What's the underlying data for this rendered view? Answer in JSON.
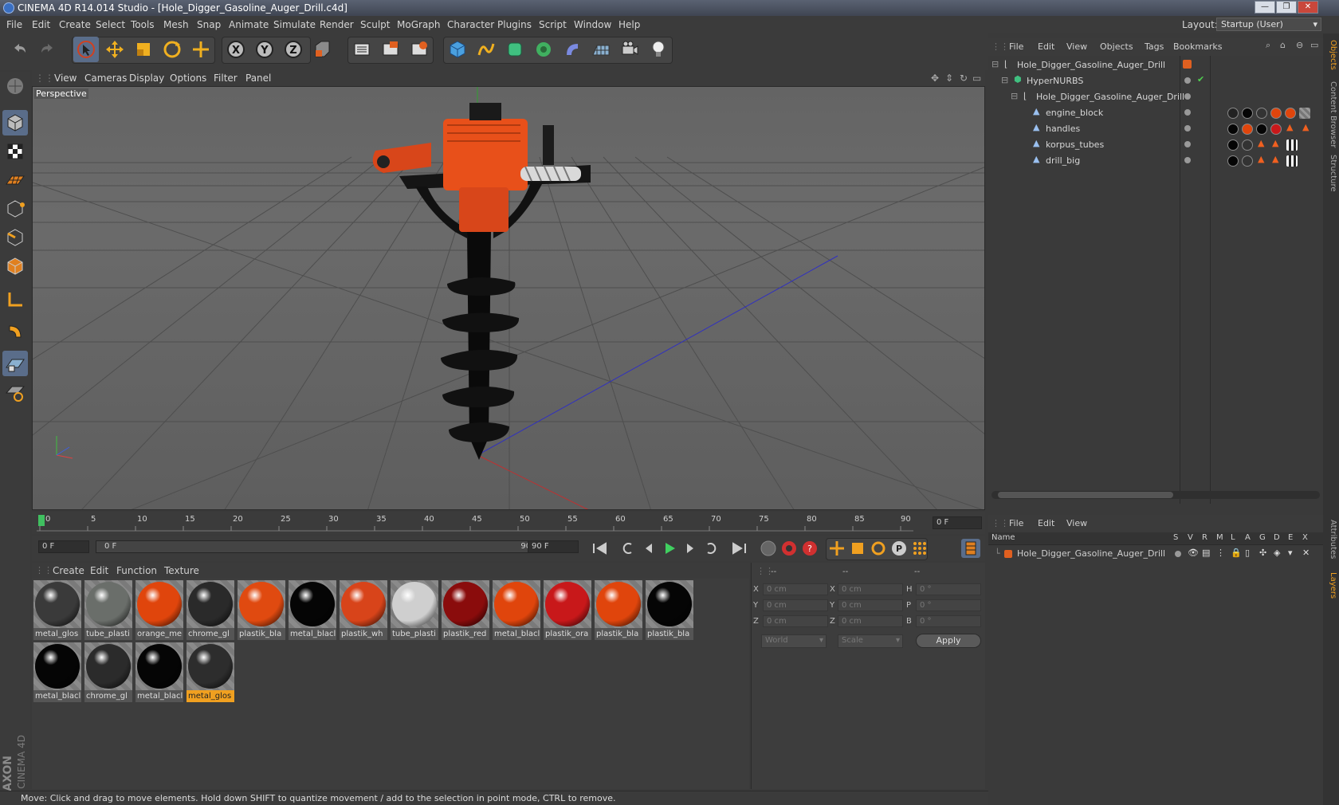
{
  "app": {
    "title": "CINEMA 4D R14.014 Studio - [Hole_Digger_Gasoline_Auger_Drill.c4d]",
    "menu": [
      "File",
      "Edit",
      "Create",
      "Select",
      "Tools",
      "Mesh",
      "Snap",
      "Animate",
      "Simulate",
      "Render",
      "Sculpt",
      "MoGraph",
      "Character",
      "Plugins",
      "Script",
      "Window",
      "Help"
    ],
    "layout_label": "Layout:",
    "layout_value": "Startup (User)",
    "brand_maxon": "MAXON",
    "brand_c4d": "CINEMA 4D"
  },
  "viewport": {
    "menu": [
      "View",
      "Cameras",
      "Display",
      "Options",
      "Filter",
      "Panel"
    ],
    "label": "Perspective"
  },
  "timeline": {
    "ticks": [
      "0",
      "5",
      "10",
      "15",
      "20",
      "25",
      "30",
      "35",
      "40",
      "45",
      "50",
      "55",
      "60",
      "65",
      "70",
      "75",
      "80",
      "85",
      "90"
    ],
    "current_frame": "0 F",
    "start_field": "0 F",
    "range_start": "0 F",
    "range_end": "90 F",
    "end_field": "90 F"
  },
  "materials": {
    "menu": [
      "Create",
      "Edit",
      "Function",
      "Texture"
    ],
    "items": [
      {
        "label": "metal_glos",
        "color": "#3a3a3a"
      },
      {
        "label": "tube_plasti",
        "color": "#6a6e6a"
      },
      {
        "label": "orange_me",
        "color": "#e0450c"
      },
      {
        "label": "chrome_gl",
        "color": "#2a2a2a"
      },
      {
        "label": "plastik_bla",
        "color": "#e04a10"
      },
      {
        "label": "metal_blacl",
        "color": "#050505"
      },
      {
        "label": "plastik_wh",
        "color": "#d8441a"
      },
      {
        "label": "tube_plasti",
        "color": "#cfcfcf"
      },
      {
        "label": "plastik_red",
        "color": "#8a0c0c"
      },
      {
        "label": "metal_blacl",
        "color": "#e0450c"
      },
      {
        "label": "plastik_ora",
        "color": "#c8181a"
      },
      {
        "label": "plastik_bla",
        "color": "#e0450c"
      },
      {
        "label": "plastik_bla",
        "color": "#050505"
      },
      {
        "label": "metal_blacl",
        "color": "#050505"
      },
      {
        "label": "chrome_gl",
        "color": "#2b2b2b"
      },
      {
        "label": "metal_blacl",
        "color": "#050505"
      },
      {
        "label": "metal_glos",
        "color": "#2d2d2d"
      }
    ]
  },
  "coordinates": {
    "headers": [
      "--",
      "--",
      "--"
    ],
    "rows": [
      {
        "a": "X",
        "av": "0 cm",
        "b": "X",
        "bv": "0 cm",
        "c": "H",
        "cv": "0 °"
      },
      {
        "a": "Y",
        "av": "0 cm",
        "b": "Y",
        "bv": "0 cm",
        "c": "P",
        "cv": "0 °"
      },
      {
        "a": "Z",
        "av": "0 cm",
        "b": "Z",
        "bv": "0 cm",
        "c": "B",
        "cv": "0 °"
      }
    ],
    "world": "World",
    "scale": "Scale",
    "apply": "Apply"
  },
  "objects": {
    "menu": [
      "File",
      "Edit",
      "View",
      "Objects",
      "Tags",
      "Bookmarks"
    ],
    "rows": [
      {
        "name": "Hole_Digger_Gasoline_Auger_Drill"
      },
      {
        "name": "HyperNURBS"
      },
      {
        "name": "Hole_Digger_Gasoline_Auger_Drill"
      },
      {
        "name": "engine_block"
      },
      {
        "name": "handles"
      },
      {
        "name": "korpus_tubes"
      },
      {
        "name": "drill_big"
      }
    ]
  },
  "layers": {
    "menu": [
      "File",
      "Edit",
      "View"
    ],
    "columns": [
      "Name",
      "S",
      "V",
      "R",
      "M",
      "L",
      "A",
      "G",
      "D",
      "E",
      "X"
    ],
    "row_name": "Hole_Digger_Gasoline_Auger_Drill"
  },
  "sidetabs": [
    "Objects",
    "Content Browser",
    "Structure",
    "Attributes",
    "Layers"
  ],
  "status": "Move: Click and drag to move elements. Hold down SHIFT to quantize movement / add to the selection in point mode, CTRL to remove."
}
